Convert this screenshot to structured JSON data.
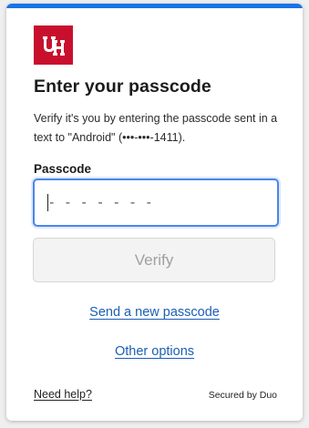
{
  "brand": {
    "logo_icon": "university-of-houston-logo",
    "logo_text": "UH",
    "logo_color": "#c8102e",
    "accent_color": "#1a73e8"
  },
  "heading": "Enter your passcode",
  "description": "Verify it's you by entering the passcode sent in a text to \"Android\" (•••-•••-1411).",
  "passcode": {
    "label": "Passcode",
    "placeholder": "- - - - - - -",
    "value": ""
  },
  "verify_button": {
    "label": "Verify"
  },
  "links": {
    "send_new": "Send a new passcode",
    "other_options": "Other options",
    "need_help": "Need help?"
  },
  "footer": {
    "secured_by": "Secured by Duo"
  }
}
